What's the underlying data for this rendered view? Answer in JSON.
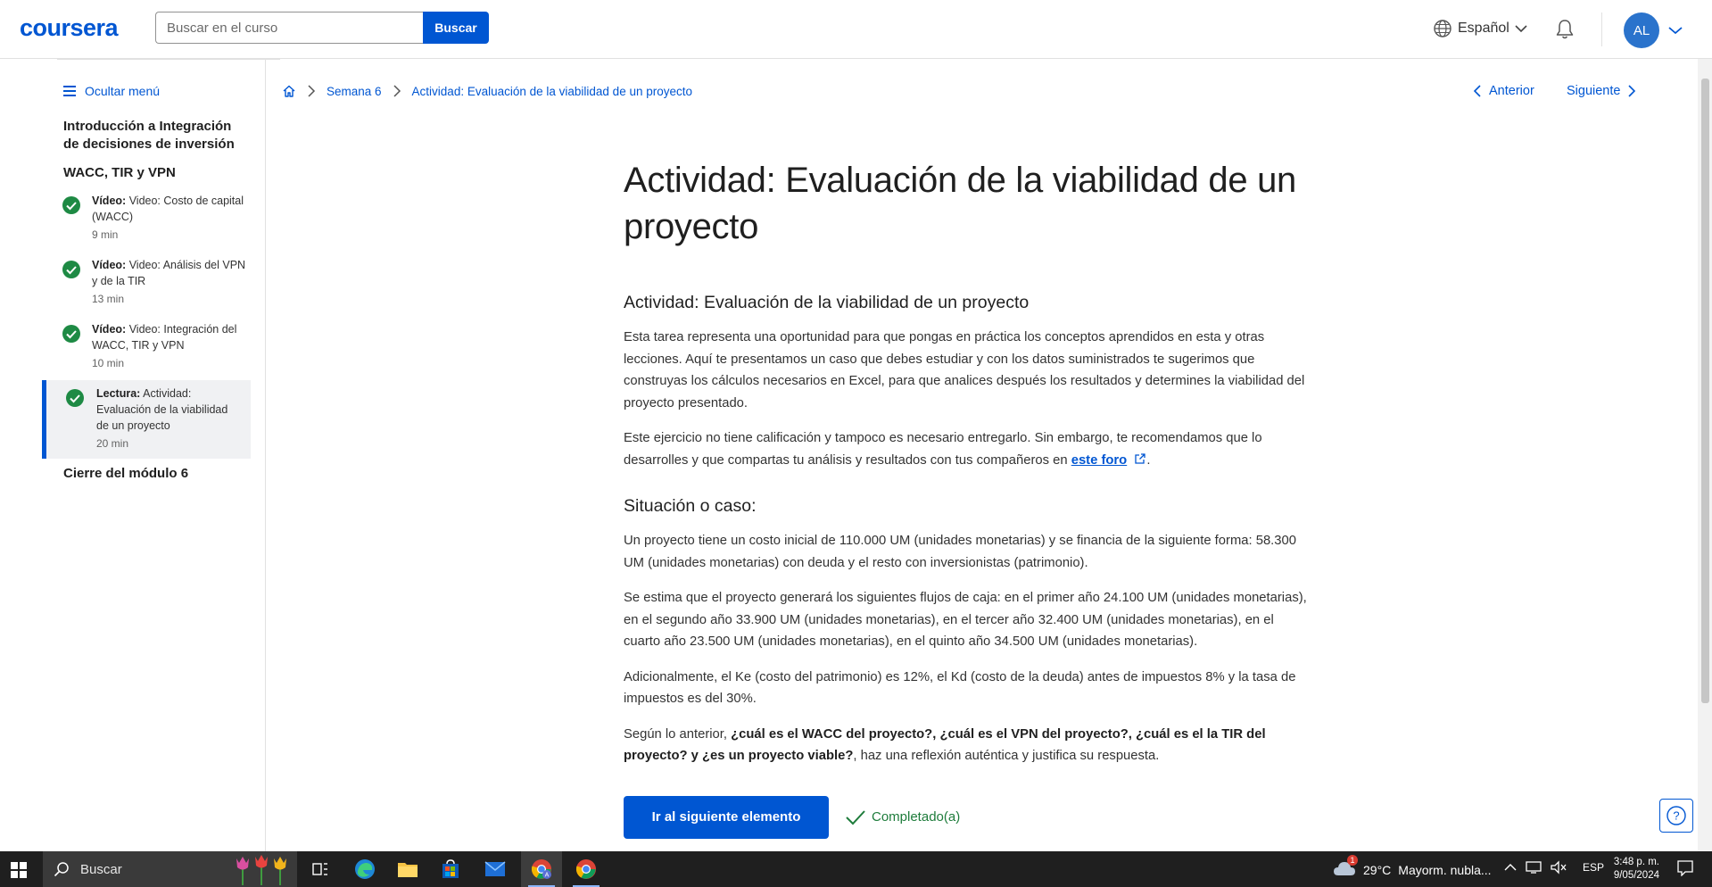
{
  "header": {
    "logo": "coursera",
    "search_placeholder": "Buscar en el curso",
    "search_button": "Buscar",
    "language": "Español",
    "avatar_initials": "AL"
  },
  "sidebar": {
    "hide_menu": "Ocultar menú",
    "course_title": "Introducción a Integración de decisiones de inversión",
    "module_title": "WACC, TIR y VPN",
    "items": [
      {
        "type": "Vídeo:",
        "title": "Video: Costo de capital (WACC)",
        "duration": "9 min",
        "status": "completed"
      },
      {
        "type": "Vídeo:",
        "title": "Video: Análisis del VPN y de la TIR",
        "duration": "13 min",
        "status": "completed"
      },
      {
        "type": "Vídeo:",
        "title": "Video: Integración del WACC, TIR y VPN",
        "duration": "10 min",
        "status": "completed"
      },
      {
        "type": "Lectura:",
        "title": "Actividad: Evaluación de la viabilidad de un proyecto",
        "duration": "20 min",
        "status": "completed",
        "active": true
      }
    ],
    "module_close": "Cierre del módulo 6"
  },
  "breadcrumb": {
    "home_icon": "home-icon",
    "week": "Semana 6",
    "current": "Actividad: Evaluación de la viabilidad de un proyecto"
  },
  "nav": {
    "previous": "Anterior",
    "next": "Siguiente"
  },
  "article": {
    "title": "Actividad: Evaluación de la viabilidad de un proyecto",
    "subtitle": "Actividad: Evaluación de la viabilidad de un proyecto",
    "intro": "Esta tarea representa una oportunidad para que pongas en práctica los conceptos aprendidos en esta y otras lecciones. Aquí te presentamos un caso que debes estudiar y con los datos suministrados te sugerimos que construyas los cálculos necesarios en Excel, para que analices después los resultados y determines la viabilidad del proyecto presentado.",
    "note_before_link": "Este ejercicio no tiene calificación y tampoco es necesario entregarlo. Sin embargo, te recomendamos que lo desarrolles y que compartas tu análisis y resultados con tus compañeros en ",
    "note_link": "este foro",
    "note_after_link": ".",
    "case_heading": "Situación o caso:",
    "case_p1": "Un proyecto tiene un costo inicial de 110.000 UM (unidades monetarias)  y se financia de la siguiente forma: 58.300 UM (unidades monetarias) con deuda y el resto con inversionistas (patrimonio).",
    "case_p2": "Se estima que el proyecto generará los siguientes flujos de caja: en el primer año 24.100 UM (unidades monetarias), en el segundo año 33.900 UM (unidades monetarias), en el tercer año 32.400 UM (unidades monetarias), en el cuarto año 23.500 UM (unidades monetarias), en el quinto año 34.500 UM (unidades monetarias).",
    "case_p3": "Adicionalmente, el Ke (costo del patrimonio) es 12%, el Kd  (costo de la deuda) antes de impuestos 8% y la tasa de impuestos es del 30%.",
    "question_prefix": "Según lo anterior, ",
    "question_bold": "¿cuál es el WACC del proyecto?, ¿cuál es el VPN del proyecto?, ¿cuál es el la TIR del proyecto? y ¿es un  proyecto viable?",
    "question_suffix": ", haz una reflexión auténtica y justifica su respuesta.",
    "next_button": "Ir al siguiente elemento",
    "completed_label": "Completado(a)"
  },
  "taskbar": {
    "search": "Buscar",
    "weather_temp": "29°C",
    "weather_text": "Mayorm. nubla...",
    "weather_badge": "1",
    "lang": "ESP",
    "time": "3:48 p. m.",
    "date": "9/05/2024",
    "colors": {
      "accent": "#0056d2",
      "success": "#1e7c3b"
    }
  }
}
